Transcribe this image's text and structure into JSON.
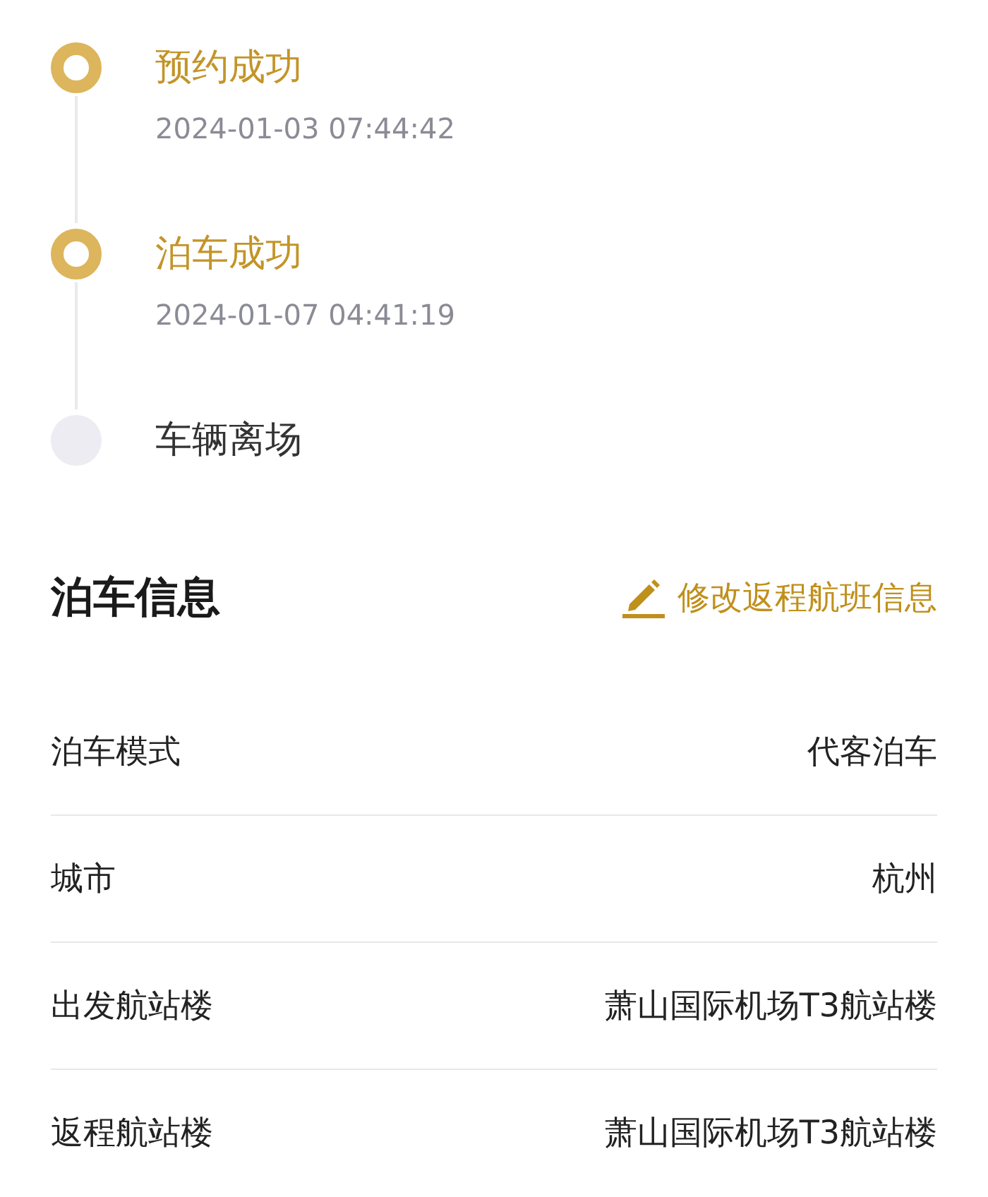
{
  "timeline": [
    {
      "title": "预约成功",
      "time": "2024-01-03 07:44:42",
      "done": true
    },
    {
      "title": "泊车成功",
      "time": "2024-01-07 04:41:19",
      "done": true
    },
    {
      "title": "车辆离场",
      "done": false
    }
  ],
  "section": {
    "title": "泊车信息",
    "action": "修改返程航班信息"
  },
  "rows": [
    {
      "label": "泊车模式",
      "value": "代客泊车"
    },
    {
      "label": "城市",
      "value": "杭州"
    },
    {
      "label": "出发航站楼",
      "value": "萧山国际机场T3航站楼"
    },
    {
      "label": "返程航站楼",
      "value": "萧山国际机场T3航站楼"
    }
  ]
}
